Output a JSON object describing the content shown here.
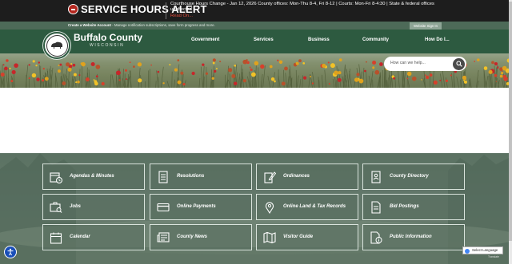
{
  "alert": {
    "title": "SERVICE HOURS ALERT",
    "message": "Courthouse Hours Change - Jan 12, 2026 County offices: Mon-Thu 8-4, Fri 8-12 | Courts: Mon-Fri 8-4:30 | State & federal offices unaffected",
    "read_on": "Read On..."
  },
  "utility": {
    "create_account": "Create a Website Account",
    "create_account_desc": " - Manage notification subscriptions, save form progress and more.",
    "sign_in": "Website Sign In"
  },
  "header": {
    "county_name": "Buffalo County",
    "state": "WISCONSIN",
    "nav": [
      "Government",
      "Services",
      "Business",
      "Community",
      "How Do I..."
    ]
  },
  "search": {
    "placeholder": "How can we help..."
  },
  "quick_links": [
    {
      "label": "Agendas & Minutes",
      "icon": "calendar-clock-icon"
    },
    {
      "label": "Resolutions",
      "icon": "document-icon"
    },
    {
      "label": "Ordinances",
      "icon": "pen-document-icon"
    },
    {
      "label": "County Directory",
      "icon": "contact-book-icon"
    },
    {
      "label": "Jobs",
      "icon": "briefcase-search-icon"
    },
    {
      "label": "Online Payments",
      "icon": "credit-card-icon"
    },
    {
      "label": "Online Land & Tax Records",
      "icon": "map-pin-icon"
    },
    {
      "label": "Bid Postings",
      "icon": "document-lines-icon"
    },
    {
      "label": "Calendar",
      "icon": "calendar-icon"
    },
    {
      "label": "County News",
      "icon": "newspaper-icon"
    },
    {
      "label": "Visitor Guide",
      "icon": "map-icon"
    },
    {
      "label": "Public Information",
      "icon": "info-document-icon"
    }
  ],
  "translate": {
    "label": "Select Language",
    "powered_by": "Translate"
  },
  "colors": {
    "alert_bg": "#1d1d1d",
    "header_green": "#2d5a40",
    "utility_green": "#4d6a58",
    "alert_red": "#b3261e"
  }
}
